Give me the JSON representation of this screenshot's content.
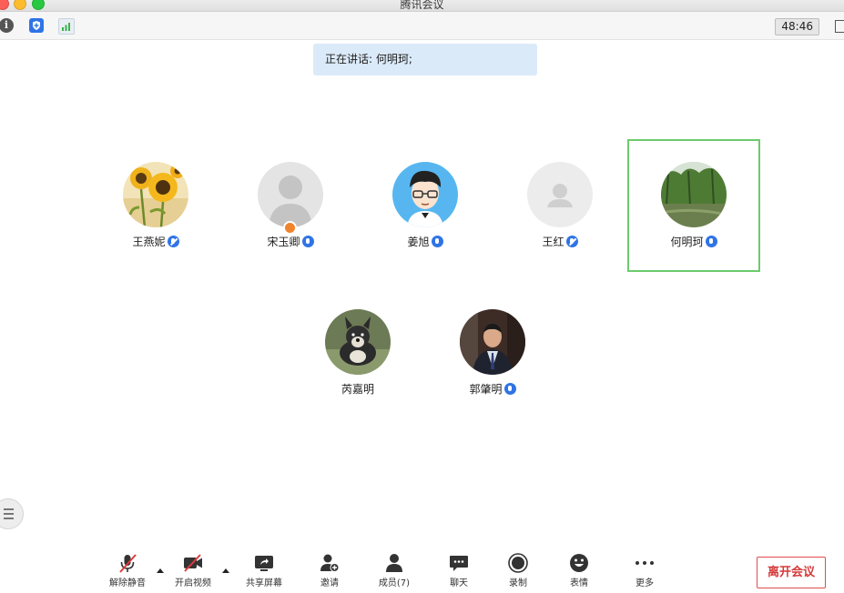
{
  "window": {
    "title": "腾讯会议"
  },
  "status": {
    "timer": "48:46"
  },
  "speaking": {
    "text": "正在讲话: 何明珂;"
  },
  "participants": [
    {
      "name": "王燕妮",
      "mic": "muted"
    },
    {
      "name": "宋玉卿",
      "mic": "on",
      "host": true
    },
    {
      "name": "姜旭",
      "mic": "on"
    },
    {
      "name": "王红",
      "mic": "muted"
    },
    {
      "name": "何明珂",
      "mic": "on",
      "speaking": true
    },
    {
      "name": "芮嘉明",
      "mic": "none"
    },
    {
      "name": "郭肇明",
      "mic": "on"
    }
  ],
  "toolbar": {
    "unmute": "解除静音",
    "video": "开启视频",
    "share": "共享屏幕",
    "invite": "邀请",
    "members": "成员(7)",
    "chat": "聊天",
    "record": "录制",
    "emoji": "表情",
    "more": "更多",
    "leave": "离开会议"
  },
  "colors": {
    "accent": "#2f74e6",
    "active_border": "#6ccb6c",
    "leave": "#d63a3a",
    "banner": "#dbeaf9"
  }
}
